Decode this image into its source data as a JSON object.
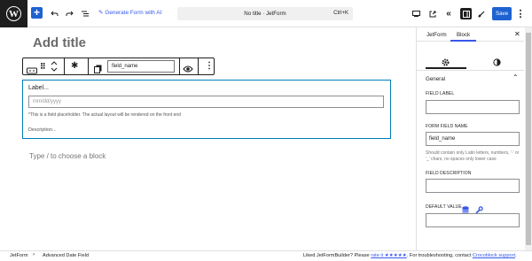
{
  "topbar": {
    "generate_label": "Generate Form with AI",
    "doc_title": "No title · JetForm",
    "shortcut": "Ctrl+K",
    "save_label": "Save"
  },
  "editor": {
    "title_placeholder": "Add title",
    "toolbar": {
      "field_name": "field_name"
    },
    "field": {
      "label": "Label...",
      "date_placeholder": "mm/dd/yyyy",
      "hint": "*This is a field placeholder. The actual layout will be rendered on the front end",
      "description": "Description..."
    },
    "type_hint": "Type / to choose a block"
  },
  "sidebar": {
    "tabs": [
      "JetForm",
      "Block"
    ],
    "section": "General",
    "field_label": "FIELD LABEL",
    "form_field_name": "FORM FIELD NAME",
    "form_field_value": "field_name",
    "help": "Should contain only Latin letters, numbers, '-' or '_' chars, no spaces only lower case",
    "field_description": "FIELD DESCRIPTION",
    "default_value": "DEFAULT VALUE"
  },
  "footer": {
    "crumbs": [
      "JetForm",
      "Advanced Date Field"
    ],
    "msg_prefix": "Liked JetFormBuilder? Please ",
    "rate_link": "rate it ★★★★★",
    "msg_mid": ". For troubleshooting, contact ",
    "support_link": "Crocoblock support",
    "msg_end": "."
  },
  "colors": {
    "accent": "#3858e9",
    "save_bg": "#1e62d0",
    "block_border": "#007cba"
  }
}
